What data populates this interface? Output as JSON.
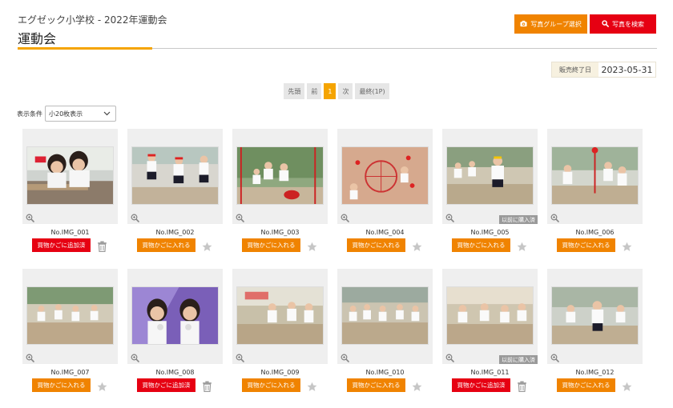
{
  "header": {
    "subtitle": "エグゼック小学校 - 2022年運動会",
    "title": "運動会",
    "photo_group_label": "写真グループ選択",
    "search_label": "写真を検索",
    "photo_group_color": "#f08300",
    "search_color": "#e60012"
  },
  "sale": {
    "label": "販売終了日",
    "date": "2023-05-31"
  },
  "pager": {
    "first": "先頭",
    "prev": "前",
    "current": "1",
    "next": "次",
    "last": "最終(1P)"
  },
  "condition": {
    "label": "表示条件",
    "selected": "小20枚表示"
  },
  "labels": {
    "added_to_cart": "買物かごに追加済",
    "add_to_cart": "買物かごに入れる",
    "previously_purchased": "以前に購入済"
  },
  "colors": {
    "accent": "#f5a400",
    "added": "#e60012",
    "add": "#f08300"
  },
  "photos": [
    {
      "id": "No.IMG_001",
      "in_cart": true,
      "purchased": false
    },
    {
      "id": "No.IMG_002",
      "in_cart": false,
      "purchased": false
    },
    {
      "id": "No.IMG_003",
      "in_cart": false,
      "purchased": false
    },
    {
      "id": "No.IMG_004",
      "in_cart": false,
      "purchased": false
    },
    {
      "id": "No.IMG_005",
      "in_cart": false,
      "purchased": true
    },
    {
      "id": "No.IMG_006",
      "in_cart": false,
      "purchased": false
    },
    {
      "id": "No.IMG_007",
      "in_cart": false,
      "purchased": false
    },
    {
      "id": "No.IMG_008",
      "in_cart": true,
      "purchased": false
    },
    {
      "id": "No.IMG_009",
      "in_cart": false,
      "purchased": false
    },
    {
      "id": "No.IMG_010",
      "in_cart": false,
      "purchased": false
    },
    {
      "id": "No.IMG_011",
      "in_cart": true,
      "purchased": true
    },
    {
      "id": "No.IMG_012",
      "in_cart": false,
      "purchased": false
    }
  ]
}
